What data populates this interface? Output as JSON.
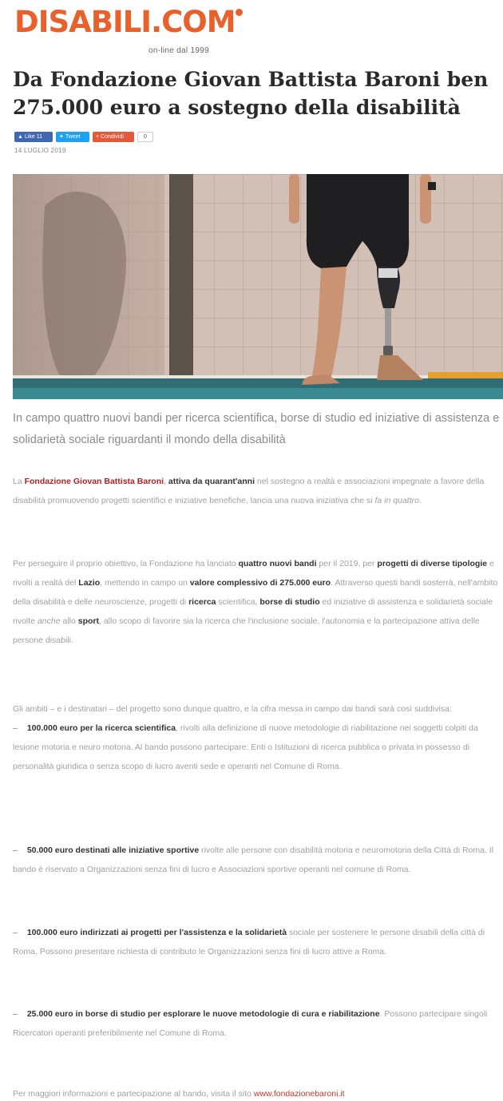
{
  "site": {
    "logo_text": "DISABILI.COM",
    "tagline": "on-line dal 1999",
    "brand_color": "#e8612c"
  },
  "article": {
    "title": "Da Fondazione Giovan Battista Baroni ben 275.000 euro a sostegno della disabilità",
    "date": "14 LUGLIO 2019",
    "share": {
      "facebook": "Like 11",
      "twitter": "Tweet",
      "google": "Condividi",
      "count": "0"
    },
    "image_alt": "Atleta con protesi alla gamba in piedi a bordo piscina",
    "lead": "In campo quattro nuovi bandi  per ricerca scientifica, borse di studio ed iniziative di assistenza e solidarietà sociale riguardanti il mondo della disabilità",
    "p1": {
      "a": "La ",
      "org": "Fondazione Giovan Battista Baroni",
      "b": ", ",
      "bold1": "attiva da quarant'anni",
      "c": " nel sostegno a realtà e associazioni impegnate a favore della disabilità promuovendo progetti scientifici e iniziative benefiche, lancia una nuova iniziativa che si ",
      "ital": "fa in quattro",
      "d": "."
    },
    "p2": {
      "a": "Per perseguire il proprio obiettivo, la Fondazione ha lanciato ",
      "b1": "quattro nuovi bandi",
      "b": " per il 2019, per ",
      "b2": "progetti di diverse tipologie",
      "c": " e rivolti a realtà del ",
      "b3": "Lazio",
      "d": ", mettendo in campo un ",
      "b4": "valore complessivo di 275.000 euro",
      "e": ". Attraverso questi bandi sosterrà, nell'ambito della disabilità e delle neuroscienze, progetti di ",
      "b5": "ricerca",
      "f": " scientifica, ",
      "b6": "borse di studio",
      "g": " ed iniziative di assistenza e solidarietà sociale rivolte ",
      "ital": "anche",
      "h": " allo ",
      "b7": "sport",
      "i": ", allo scopo di favorire sia la ricerca che l'inclusione sociale, l'autonomia e la partecipazione attiva delle persone disabili."
    },
    "p3_intro": "Gli ambiti – e i destinatari – del progetto sono dunque quattro, e la  cifra messa in campo dai bandi sarà così suddivisa:",
    "items": [
      {
        "bold": "100.000 euro per la ricerca scientifica",
        "text": ", rivolti alla definizione di nuove metodologie di riabilitazione nei soggetti colpiti da lesione motoria e neuro motoria. Al bando possono partecipare: Enti o Istituzioni di ricerca pubblica o privata in possesso di personalità giuridica o senza scopo di lucro aventi sede e operanti nel Comune di Roma."
      },
      {
        "bold": "50.000 euro destinati alle iniziative sportive",
        "text": " rivolte alle persone con disabilità motoria e neuromotoria della Città di Roma. Il bando è riservato a Organizzazioni senza fini di lucro e Associazioni sportive operanti nel comune di Roma."
      },
      {
        "bold": "100.000 euro indirizzati ai progetti per l'assistenza e la solidarietà",
        "text": " sociale per sostenere le persone disabili della città di Roma. Possono presentare richiesta di contributo le Organizzazioni senza fini di lucro attive a Roma."
      },
      {
        "bold": "25.000 euro in borse di studio per esplorare le nuove metodologie di cura e riabilitazione",
        "text": ". Possono partecipare singoli Ricercatori operanti preferibilmente nel Comune di Roma."
      }
    ],
    "footer_text": "Per maggiori informazioni e partecipazione al bando, visita il sito ",
    "footer_link": "www.fondazionebaroni.it"
  }
}
